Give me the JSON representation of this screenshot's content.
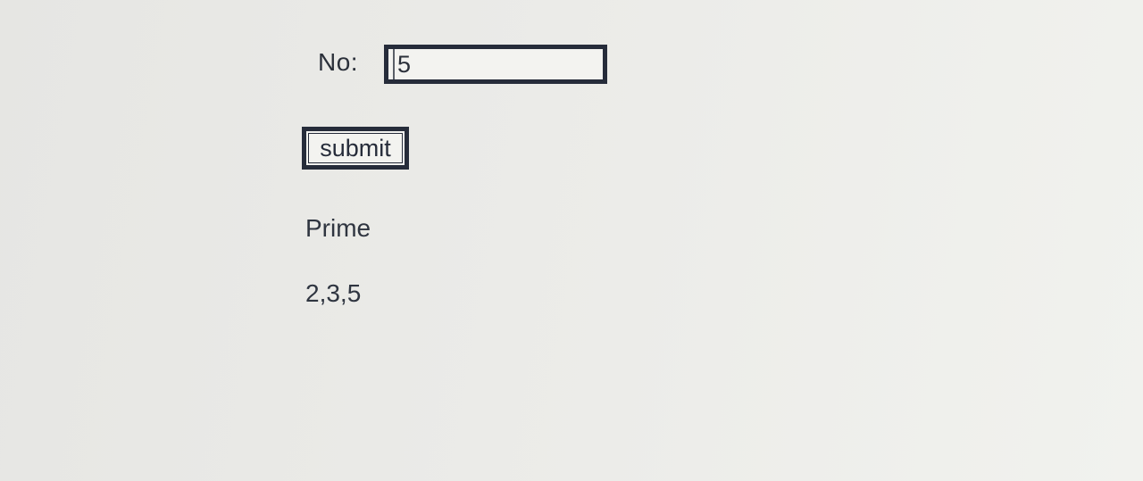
{
  "form": {
    "no_label": "No:",
    "no_value": "5",
    "submit_label": "submit"
  },
  "result": {
    "title": "Prime",
    "value": "2,3,5"
  }
}
